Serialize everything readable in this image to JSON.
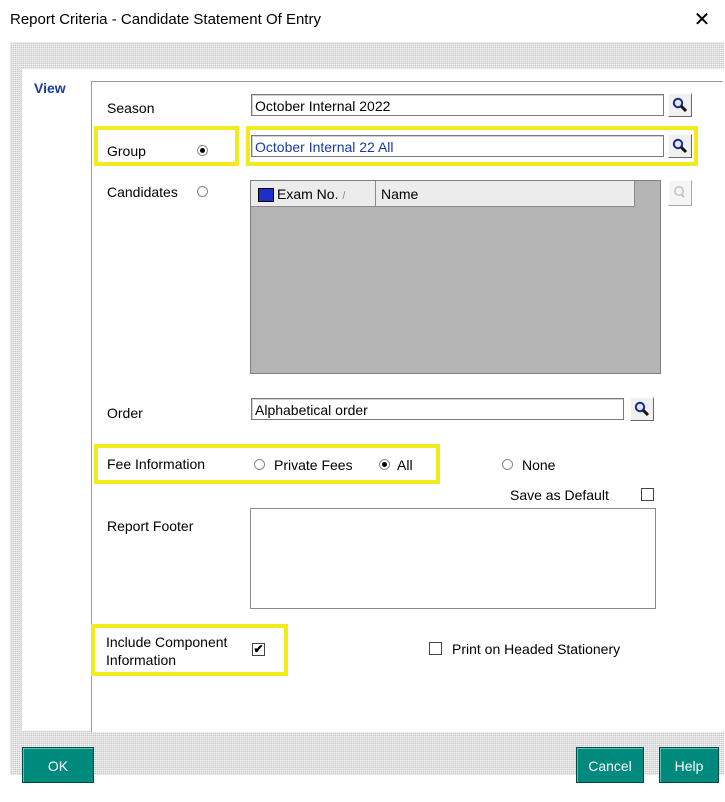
{
  "window": {
    "title": "Report Criteria - Candidate Statement Of Entry",
    "close_glyph": "✕"
  },
  "tab": {
    "label": "View"
  },
  "season": {
    "label": "Season",
    "value": "October Internal 2022"
  },
  "group": {
    "label": "Group",
    "value": "October Internal 22 All",
    "selected": true
  },
  "candidates": {
    "label": "Candidates",
    "selected": false,
    "columns": [
      "Exam No.",
      "Name"
    ],
    "sort_indicator": "/"
  },
  "order": {
    "label": "Order",
    "value": "Alphabetical order"
  },
  "fees": {
    "label": "Fee Information",
    "options": [
      "Private Fees",
      "All",
      "None"
    ],
    "selected": "All"
  },
  "save_default": {
    "label": "Save as Default",
    "checked": false
  },
  "report_footer": {
    "label": "Report Footer",
    "value": ""
  },
  "component": {
    "label_line1": "Include Component",
    "label_line2": "Information",
    "checked": true,
    "check_glyph": "✔"
  },
  "headed": {
    "label": "Print on Headed Stationery",
    "checked": false
  },
  "buttons": {
    "ok": "OK",
    "cancel": "Cancel",
    "help": "Help"
  },
  "colors": {
    "highlight": "#f2ea1a",
    "button": "#008a7e",
    "tab_label": "#1a3aa8",
    "group_value": "#1a3aa8"
  }
}
